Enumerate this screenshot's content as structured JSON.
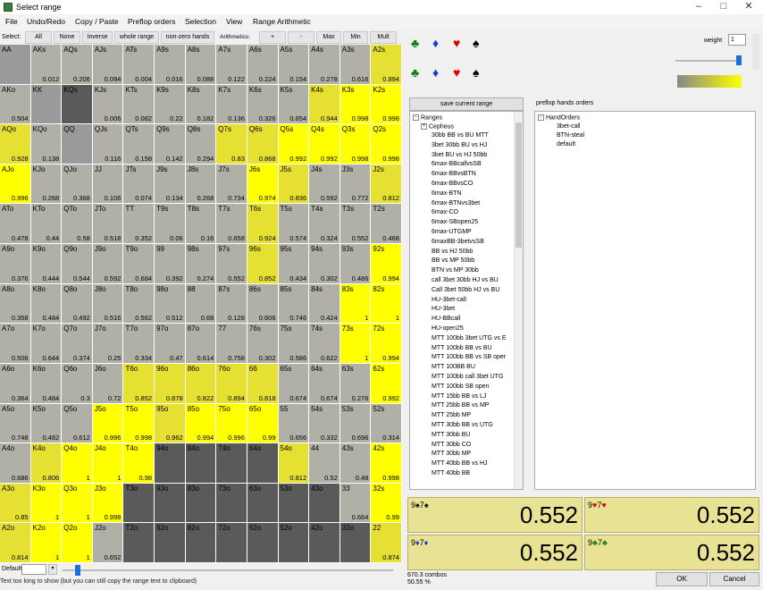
{
  "window": {
    "title": "Select range"
  },
  "menu": [
    "File",
    "Undo/Redo",
    "Copy / Paste",
    "Preflop orders",
    "Selection",
    "View",
    "Range Arithmetic"
  ],
  "selectbar": {
    "label": "Select:",
    "buttons": [
      "All",
      "None",
      "Inverse",
      "whole range",
      "non-zero hands",
      "Arithmetics:",
      "+",
      "-",
      "Max",
      "Min",
      "Mult"
    ]
  },
  "colors": {
    "full": "#ffff00",
    "zero": "#555555",
    "mid_low": "#888888",
    "high_end": "#ffff00"
  },
  "grid": {
    "rows": [
      [
        [
          "AA",
          ""
        ],
        [
          "AKs",
          "0.012"
        ],
        [
          "AQs",
          "0.206"
        ],
        [
          "AJs",
          "0.094"
        ],
        [
          "ATs",
          "0.004"
        ],
        [
          "A9s",
          "0.016"
        ],
        [
          "A8s",
          "0.088"
        ],
        [
          "A7s",
          "0.122"
        ],
        [
          "A6s",
          "0.224"
        ],
        [
          "A5s",
          "0.154"
        ],
        [
          "A4s",
          "0.278"
        ],
        [
          "A3s",
          "0.616"
        ],
        [
          "A2s",
          "0.894"
        ]
      ],
      [
        [
          "AKo",
          "0.504"
        ],
        [
          "KK",
          ""
        ],
        [
          "KQs",
          ""
        ],
        [
          "KJs",
          "0.006"
        ],
        [
          "KTs",
          "0.082"
        ],
        [
          "K9s",
          "0.22"
        ],
        [
          "K8s",
          "0.182"
        ],
        [
          "K7s",
          "0.136"
        ],
        [
          "K6s",
          "0.326"
        ],
        [
          "K5s",
          "0.654"
        ],
        [
          "K4s",
          "0.944"
        ],
        [
          "K3s",
          "0.998"
        ],
        [
          "K2s",
          "0.998"
        ]
      ],
      [
        [
          "AQo",
          "0.928"
        ],
        [
          "KQo",
          "0.138"
        ],
        [
          "QQ",
          ""
        ],
        [
          "QJs",
          "0.116"
        ],
        [
          "QTs",
          "0.158"
        ],
        [
          "Q9s",
          "0.142"
        ],
        [
          "Q8s",
          "0.294"
        ],
        [
          "Q7s",
          "0.83"
        ],
        [
          "Q6s",
          "0.868"
        ],
        [
          "Q5s",
          "0.992"
        ],
        [
          "Q4s",
          "0.992"
        ],
        [
          "Q3s",
          "0.998"
        ],
        [
          "Q2s",
          "0.998"
        ]
      ],
      [
        [
          "AJo",
          "0.996"
        ],
        [
          "KJo",
          "0.268"
        ],
        [
          "QJo",
          "0.368"
        ],
        [
          "JJ",
          "0.106"
        ],
        [
          "JTs",
          "0.074"
        ],
        [
          "J9s",
          "0.134"
        ],
        [
          "J8s",
          "0.268"
        ],
        [
          "J7s",
          "0.734"
        ],
        [
          "J6s",
          "0.974"
        ],
        [
          "J5s",
          "0.836"
        ],
        [
          "J4s",
          "0.592"
        ],
        [
          "J3s",
          "0.772"
        ],
        [
          "J2s",
          "0.812"
        ]
      ],
      [
        [
          "ATo",
          "0.478"
        ],
        [
          "KTo",
          "0.44"
        ],
        [
          "QTo",
          "0.58"
        ],
        [
          "JTo",
          "0.518"
        ],
        [
          "TT",
          "0.352"
        ],
        [
          "T9s",
          "0.06"
        ],
        [
          "T8s",
          "0.16"
        ],
        [
          "T7s",
          "0.658"
        ],
        [
          "T6s",
          "0.924"
        ],
        [
          "T5s",
          "0.574"
        ],
        [
          "T4s",
          "0.324"
        ],
        [
          "T3s",
          "0.552"
        ],
        [
          "T2s",
          "0.468"
        ]
      ],
      [
        [
          "A9o",
          "0.376"
        ],
        [
          "K9o",
          "0.444"
        ],
        [
          "Q9o",
          "0.544"
        ],
        [
          "J9o",
          "0.592"
        ],
        [
          "T9o",
          "0.684"
        ],
        [
          "99",
          "0.392"
        ],
        [
          "98s",
          "0.274"
        ],
        [
          "97s",
          "0.552"
        ],
        [
          "96s",
          "0.852"
        ],
        [
          "95s",
          "0.434"
        ],
        [
          "94s",
          "0.302"
        ],
        [
          "93s",
          "0.486"
        ],
        [
          "92s",
          "0.994"
        ]
      ],
      [
        [
          "A8o",
          "0.358"
        ],
        [
          "K8o",
          "0.484"
        ],
        [
          "Q8o",
          "0.492"
        ],
        [
          "J8o",
          "0.516"
        ],
        [
          "T8o",
          "0.562"
        ],
        [
          "98o",
          "0.512"
        ],
        [
          "88",
          "0.68"
        ],
        [
          "87s",
          "0.128"
        ],
        [
          "86s",
          "0.606"
        ],
        [
          "85s",
          "0.746"
        ],
        [
          "84s",
          "0.424"
        ],
        [
          "83s",
          "1"
        ],
        [
          "82s",
          "1"
        ]
      ],
      [
        [
          "A7o",
          "0.506"
        ],
        [
          "K7o",
          "0.644"
        ],
        [
          "Q7o",
          "0.374"
        ],
        [
          "J7o",
          "0.25"
        ],
        [
          "T7o",
          "0.334"
        ],
        [
          "97o",
          "0.47"
        ],
        [
          "87o",
          "0.614"
        ],
        [
          "77",
          "0.758"
        ],
        [
          "76s",
          "0.302"
        ],
        [
          "75s",
          "0.586"
        ],
        [
          "74s",
          "0.622"
        ],
        [
          "73s",
          "1"
        ],
        [
          "72s",
          "0.994"
        ]
      ],
      [
        [
          "A6o",
          "0.364"
        ],
        [
          "K6o",
          "0.484"
        ],
        [
          "Q6o",
          "0.3"
        ],
        [
          "J6o",
          "0.72"
        ],
        [
          "T6o",
          "0.852"
        ],
        [
          "96o",
          "0.878"
        ],
        [
          "86o",
          "0.822"
        ],
        [
          "76o",
          "0.894"
        ],
        [
          "66",
          "0.818"
        ],
        [
          "65s",
          "0.674"
        ],
        [
          "64s",
          "0.674"
        ],
        [
          "63s",
          "0.276"
        ],
        [
          "62s",
          "0.992"
        ]
      ],
      [
        [
          "A5o",
          "0.748"
        ],
        [
          "K5o",
          "0.482"
        ],
        [
          "Q5o",
          "0.612"
        ],
        [
          "J5o",
          "0.996"
        ],
        [
          "T5o",
          "0.998"
        ],
        [
          "95o",
          "0.962"
        ],
        [
          "85o",
          "0.994"
        ],
        [
          "75o",
          "0.996"
        ],
        [
          "65o",
          "0.99"
        ],
        [
          "55",
          "0.656"
        ],
        [
          "54s",
          "0.332"
        ],
        [
          "53s",
          "0.696"
        ],
        [
          "52s",
          "0.314"
        ]
      ],
      [
        [
          "A4o",
          "0.686"
        ],
        [
          "K4o",
          "0.806"
        ],
        [
          "Q4o",
          "1"
        ],
        [
          "J4o",
          "1"
        ],
        [
          "T4o",
          "0.98"
        ],
        [
          "94o",
          ""
        ],
        [
          "84o",
          ""
        ],
        [
          "74o",
          ""
        ],
        [
          "64o",
          ""
        ],
        [
          "54o",
          "0.812"
        ],
        [
          "44",
          "0.52"
        ],
        [
          "43s",
          "0.48"
        ],
        [
          "42s",
          "0.998"
        ]
      ],
      [
        [
          "A3o",
          "0.85"
        ],
        [
          "K3o",
          "1"
        ],
        [
          "Q3o",
          "1"
        ],
        [
          "J3o",
          "0.998"
        ],
        [
          "T3o",
          ""
        ],
        [
          "93o",
          ""
        ],
        [
          "83o",
          ""
        ],
        [
          "73o",
          ""
        ],
        [
          "63o",
          ""
        ],
        [
          "53o",
          ""
        ],
        [
          "43o",
          ""
        ],
        [
          "33",
          "0.664"
        ],
        [
          "32s",
          "0.99"
        ]
      ],
      [
        [
          "A2o",
          "0.814"
        ],
        [
          "K2o",
          "1"
        ],
        [
          "Q2o",
          "1"
        ],
        [
          "J2o",
          "0.652"
        ],
        [
          "T2o",
          ""
        ],
        [
          "92o",
          ""
        ],
        [
          "82o",
          ""
        ],
        [
          "72o",
          ""
        ],
        [
          "62o",
          ""
        ],
        [
          "52o",
          ""
        ],
        [
          "42o",
          ""
        ],
        [
          "32o",
          ""
        ],
        [
          "22",
          "0.874"
        ]
      ]
    ]
  },
  "bottombar": {
    "label": "Default",
    "value": ""
  },
  "status": "Text too long to show (but you can still copy the range text to clipboard)",
  "right": {
    "weight_label": "weight",
    "weight_value": "1",
    "save_button": "save current range",
    "orders_label": "preflop hands orders",
    "ranges_root": "Ranges",
    "ranges_sub": "Cepheus",
    "ranges": [
      "30bb BB vs BU MTT",
      "3bet 30bb BU vs HJ",
      "3bet BU vs HJ 50bb",
      "6max-BBcallvsSB",
      "6max-BBvsBTN",
      "6max-BBvsCO",
      "6max-BTN",
      "6max-BTNvs3bet",
      "6max-CO",
      "6max-SBopen25",
      "6max-UTGMP",
      "6maxBB-3betvsSB",
      "BB vs HJ 50bb",
      "BB vs MP 50bb",
      "BTN vs MP 30bb",
      "call 3bet 30bb HJ vs BU",
      "Call 3bet 50bb HJ vs BU",
      "HU-3bet-call",
      "HU-3bet",
      "HU-BBcall",
      "HU-open25",
      "MTT 100bb 3bet UTG vs E",
      "MTT 100bb BB vs BU",
      "MTT 100bb BB vs SB oper",
      "MTT 100BB BU",
      "MTT 100bb call 3bet UTG",
      "MTT 100bb SB open",
      "MTT 15bb BB vs LJ",
      "MTT 25bb BB vs MP",
      "MTT 25bb MP",
      "MTT 30bb BB vs UTG",
      "MTT 30bb BU",
      "MTT 30bb CO",
      "MTT 30bb MP",
      "MTT 40bb BB vs HJ",
      "MTT 40bb BB"
    ],
    "orders_root": "HandOrders",
    "orders": [
      "3bet-call",
      "BTN-steal",
      "default"
    ],
    "combos": [
      {
        "label_rank1": "9",
        "label_suit1": "♠",
        "label_rank2": "7",
        "label_suit2": "♠",
        "c1": "black",
        "c2": "black",
        "value": "0.552"
      },
      {
        "label_rank1": "9",
        "label_suit1": "♥",
        "label_rank2": "7",
        "label_suit2": "♥",
        "c1": "red",
        "c2": "red",
        "value": "0.552"
      },
      {
        "label_rank1": "9",
        "label_suit1": "♦",
        "label_rank2": "7",
        "label_suit2": "♦",
        "c1": "blue",
        "c2": "blue",
        "value": "0.552"
      },
      {
        "label_rank1": "9",
        "label_suit1": "♣",
        "label_rank2": "7",
        "label_suit2": "♣",
        "c1": "green",
        "c2": "green",
        "value": "0.552"
      }
    ],
    "combos_count": "670.3 combos",
    "combos_pct": "50.55 %",
    "ok": "OK",
    "cancel": "Cancel"
  }
}
